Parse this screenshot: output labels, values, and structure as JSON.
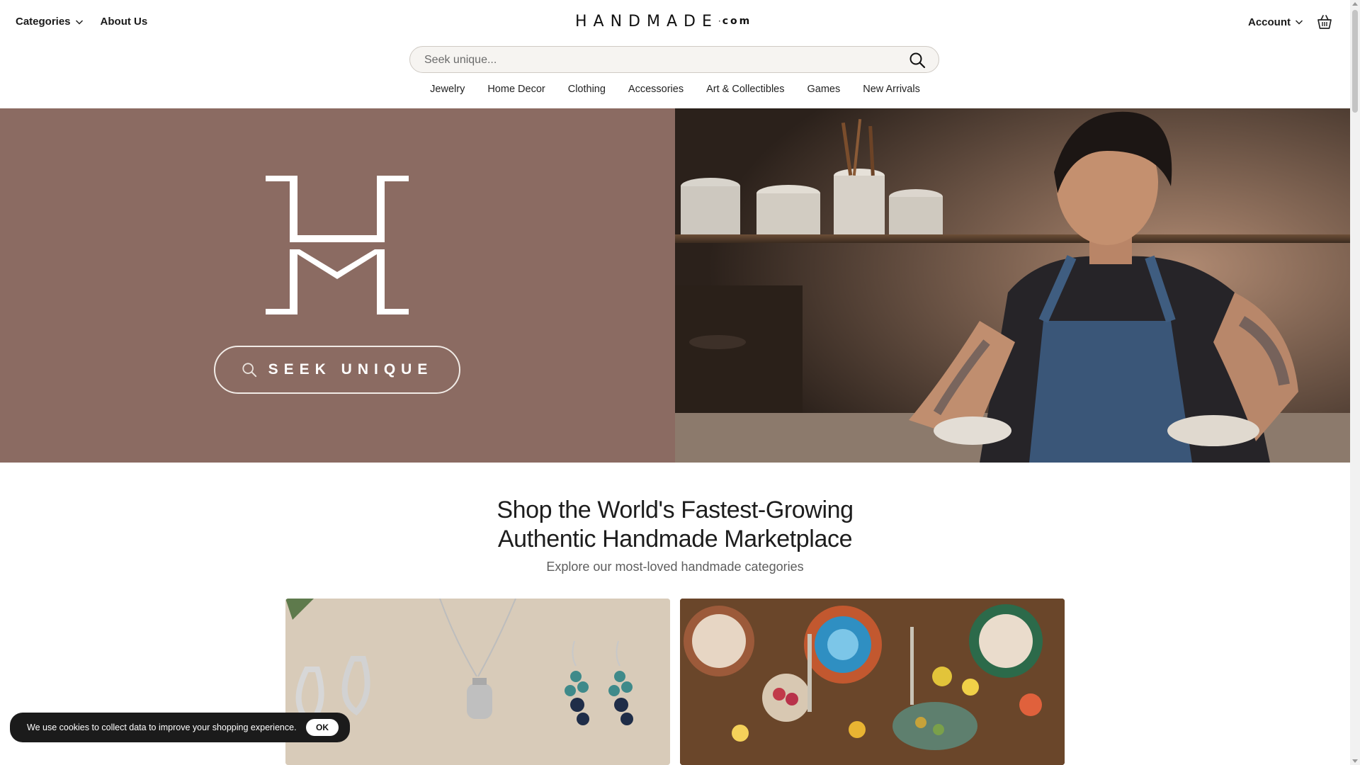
{
  "header": {
    "categories_label": "Categories",
    "about_label": "About Us",
    "logo_main": "HANDMADE",
    "logo_dot": "·",
    "logo_suffix": "com",
    "account_label": "Account"
  },
  "search": {
    "placeholder": "Seek unique..."
  },
  "category_nav": [
    "Jewelry",
    "Home Decor",
    "Clothing",
    "Accessories",
    "Art & Collectibles",
    "Games",
    "New Arrivals"
  ],
  "hero": {
    "button_label": "SEEK UNIQUE",
    "background_color": "#8b6b62"
  },
  "section": {
    "headline_line1": "Shop the World's Fastest-Growing",
    "headline_line2": "Authentic Handmade Marketplace",
    "subheadline": "Explore our most-loved handmade categories"
  },
  "cookie": {
    "message": "We use cookies to collect data to improve your shopping experience.",
    "ok_label": "OK"
  },
  "icons": [
    "chevron-down-icon",
    "search-icon",
    "basket-icon",
    "hm-logo-icon"
  ]
}
